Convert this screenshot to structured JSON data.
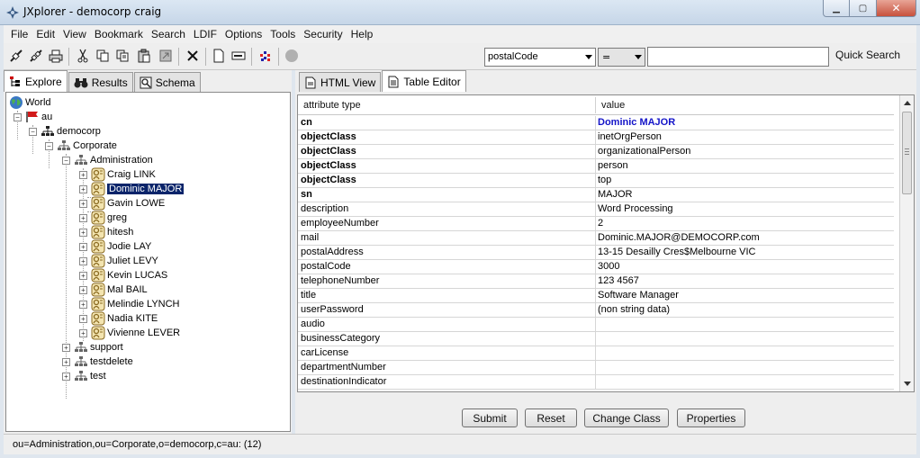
{
  "window": {
    "title": "JXplorer - democorp craig"
  },
  "menu": [
    "File",
    "Edit",
    "View",
    "Bookmark",
    "Search",
    "LDIF",
    "Options",
    "Tools",
    "Security",
    "Help"
  ],
  "toolbar": {
    "icons": [
      "connect-icon",
      "disconnect-icon",
      "print-icon",
      "cut-icon",
      "copy-icon",
      "copy-dn-icon",
      "paste-icon",
      "paste-alias-icon",
      "delete-icon",
      "new-entry-icon",
      "rename-icon",
      "refresh-icon",
      "stop-icon"
    ],
    "search_attribute": "postalCode",
    "search_operator": "=",
    "search_value": "",
    "quick_search_label": "Quick Search"
  },
  "left_tabs": [
    {
      "label": "Explore",
      "icon": "tree-icon",
      "active": true
    },
    {
      "label": "Results",
      "icon": "binoculars-icon",
      "active": false
    },
    {
      "label": "Schema",
      "icon": "schema-icon",
      "active": false
    }
  ],
  "tree": {
    "world": "World",
    "au": "au",
    "democorp": "democorp",
    "corporate": "Corporate",
    "administration": "Administration",
    "people": [
      "Craig LINK",
      "Dominic MAJOR",
      "Gavin LOWE",
      "greg",
      "hitesh",
      "Jodie LAY",
      "Juliet LEVY",
      "Kevin LUCAS",
      "Mal BAIL",
      "Melindie LYNCH",
      "Nadia KITE",
      "Vivienne LEVER"
    ],
    "selected": "Dominic MAJOR",
    "support": "support",
    "testdelete": "testdelete",
    "test": "test"
  },
  "right_tabs": [
    {
      "label": "HTML View",
      "icon": "html-view-icon",
      "active": false
    },
    {
      "label": "Table Editor",
      "icon": "table-editor-icon",
      "active": true
    }
  ],
  "table": {
    "headers": [
      "attribute type",
      "value"
    ],
    "rows": [
      {
        "attr": "cn",
        "value": "Dominic MAJOR",
        "bold": true,
        "highlight": true
      },
      {
        "attr": "objectClass",
        "value": "inetOrgPerson",
        "bold": true
      },
      {
        "attr": "objectClass",
        "value": "organizationalPerson",
        "bold": true
      },
      {
        "attr": "objectClass",
        "value": "person",
        "bold": true
      },
      {
        "attr": "objectClass",
        "value": "top",
        "bold": true
      },
      {
        "attr": "sn",
        "value": "MAJOR",
        "bold": true
      },
      {
        "attr": "description",
        "value": "Word Processing"
      },
      {
        "attr": "employeeNumber",
        "value": "2"
      },
      {
        "attr": "mail",
        "value": "Dominic.MAJOR@DEMOCORP.com"
      },
      {
        "attr": "postalAddress",
        "value": "13-15 Desailly Cres$Melbourne VIC"
      },
      {
        "attr": "postalCode",
        "value": "3000"
      },
      {
        "attr": "telephoneNumber",
        "value": "123 4567"
      },
      {
        "attr": "title",
        "value": "Software Manager"
      },
      {
        "attr": "userPassword",
        "value": "(non string data)"
      },
      {
        "attr": "audio",
        "value": ""
      },
      {
        "attr": "businessCategory",
        "value": ""
      },
      {
        "attr": "carLicense",
        "value": ""
      },
      {
        "attr": "departmentNumber",
        "value": ""
      },
      {
        "attr": "destinationIndicator",
        "value": ""
      }
    ]
  },
  "buttons": {
    "submit": "Submit",
    "reset": "Reset",
    "change_class": "Change Class",
    "properties": "Properties"
  },
  "status": "ou=Administration,ou=Corporate,o=democorp,c=au: (12)",
  "colors": {
    "selection": "#0a246a",
    "cn_value": "#1414c8"
  }
}
